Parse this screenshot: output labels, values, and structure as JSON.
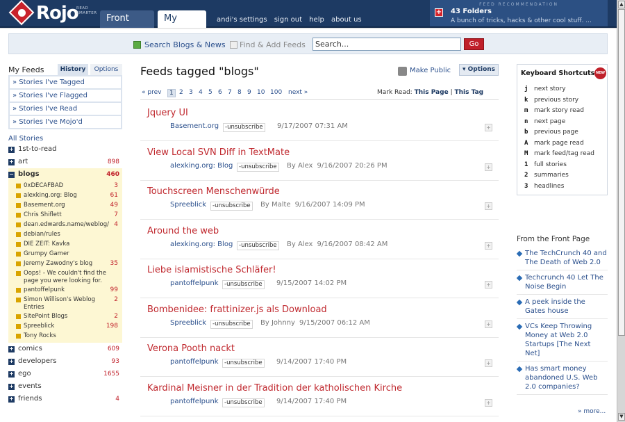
{
  "header": {
    "brand": "Rojo",
    "tagline": [
      "READ",
      "SMARTER"
    ],
    "tabs": [
      {
        "label": "Front Page"
      },
      {
        "label": "My Feeds"
      }
    ],
    "links": [
      "andi's settings",
      "sign out",
      "help",
      "about us"
    ],
    "feed_rec": {
      "label": "FEED RECOMMENDATION",
      "title": "43 Folders",
      "subtitle": "A bunch of tricks, hacks & other cool stuff. ..."
    }
  },
  "search": {
    "option1": "Search Blogs & News",
    "option2": "Find & Add Feeds",
    "value": "Search...",
    "go": "Go"
  },
  "sidebar": {
    "title": "My Feeds",
    "tabs": [
      "History",
      "Options"
    ],
    "history": [
      "» Stories I've Tagged",
      "» Stories I've Flagged",
      "» Stories I've Read",
      "» Stories I've Mojo'd"
    ],
    "all_stories": "All Stories",
    "folders_top": [
      {
        "name": "1st-to-read",
        "count": ""
      },
      {
        "name": "art",
        "count": "898"
      }
    ],
    "open_folder": {
      "name": "blogs",
      "count": "460"
    },
    "blogs": [
      {
        "name": "0xDECAFBAD",
        "count": "3"
      },
      {
        "name": "alexking.org: Blog",
        "count": "61"
      },
      {
        "name": "Basement.org",
        "count": "49"
      },
      {
        "name": "Chris Shiflett",
        "count": "7"
      },
      {
        "name": "dean.edwards.name/weblog/",
        "count": "4"
      },
      {
        "name": "debian/rules",
        "count": ""
      },
      {
        "name": "DIE ZEIT: Kavka",
        "count": ""
      },
      {
        "name": "Grumpy Gamer",
        "count": ""
      },
      {
        "name": "Jeremy Zawodny's blog",
        "count": "35"
      },
      {
        "name": "Oops! - We couldn't find the page you were looking for.",
        "count": ""
      },
      {
        "name": "pantoffelpunk",
        "count": "99"
      },
      {
        "name": "Simon Willison's Weblog Entries",
        "count": "2"
      },
      {
        "name": "SitePoint Blogs",
        "count": "2"
      },
      {
        "name": "Spreeblick",
        "count": "198"
      },
      {
        "name": "Tony Rocks",
        "count": ""
      }
    ],
    "folders_bottom": [
      {
        "name": "comics",
        "count": "609"
      },
      {
        "name": "developers",
        "count": "93"
      },
      {
        "name": "ego",
        "count": "1655"
      },
      {
        "name": "events",
        "count": ""
      },
      {
        "name": "friends",
        "count": "4"
      }
    ]
  },
  "main": {
    "title": "Feeds tagged \"blogs\"",
    "make_public": "Make Public",
    "options": "Options",
    "pager": {
      "prev": "« prev",
      "pages": [
        "1",
        "2",
        "3",
        "4",
        "5",
        "6",
        "7",
        "8",
        "9",
        "10",
        "100"
      ],
      "next": "next »"
    },
    "mark_read": {
      "label": "Mark Read:",
      "this_page": "This Page",
      "sep": "|",
      "this_tag": "This Tag"
    },
    "unsubscribe": "-unsubscribe",
    "stories": [
      {
        "title": "Jquery UI",
        "source": "Basement.org",
        "author": "",
        "date": "9/17/2007 07:31 AM"
      },
      {
        "title": "View Local SVN Diff in TextMate",
        "source": "alexking.org: Blog",
        "author": "By Alex",
        "date": "9/16/2007 20:26 PM"
      },
      {
        "title": "Touchscreen Menschenwürde",
        "source": "Spreeblick",
        "author": "By Malte",
        "date": "9/16/2007 14:09 PM"
      },
      {
        "title": "Around the web",
        "source": "alexking.org: Blog",
        "author": "By Alex",
        "date": "9/16/2007 08:42 AM"
      },
      {
        "title": "Liebe islamistische Schläfer!",
        "source": "pantoffelpunk",
        "author": "",
        "date": "9/15/2007 14:02 PM"
      },
      {
        "title": "Bombenidee: frattinizer.js als Download",
        "source": "Spreeblick",
        "author": "By Johnny",
        "date": "9/15/2007 06:12 AM"
      },
      {
        "title": "Verona Pooth nackt",
        "source": "pantoffelpunk",
        "author": "",
        "date": "9/14/2007 17:40 PM"
      },
      {
        "title": "Kardinal Meisner in der Tradition der katholischen Kirche",
        "source": "pantoffelpunk",
        "author": "",
        "date": "9/14/2007 17:40 PM"
      }
    ]
  },
  "right": {
    "shortcuts_title": "Keyboard Shortcuts",
    "new_badge": "NEW",
    "shortcuts": [
      {
        "key": "j",
        "desc": "next story"
      },
      {
        "key": "k",
        "desc": "previous story"
      },
      {
        "key": "m",
        "desc": "mark story read"
      },
      {
        "key": "n",
        "desc": "next page"
      },
      {
        "key": "b",
        "desc": "previous page"
      },
      {
        "key": "A",
        "desc": "mark page read"
      },
      {
        "key": "M",
        "desc": "mark feed/tag read"
      },
      {
        "key": "1",
        "desc": "full stories"
      },
      {
        "key": "2",
        "desc": "summaries"
      },
      {
        "key": "3",
        "desc": "headlines"
      }
    ],
    "front_page_title": "From the Front Page",
    "front_page": [
      "The TechCrunch 40 and The Death of Web 2.0",
      "Techcrunch 40 Let The Noise Begin",
      "A peek inside the Gates house",
      "VCs Keep Throwing Money at Web 2.0 Startups [The Next Net]",
      "Has smart money abandoned U.S. Web 2.0 companies?"
    ],
    "more": "» more..."
  },
  "colors": {
    "header": "#1d3a63",
    "accent": "#c0202a",
    "link": "#2a4f8c",
    "blogs_bg": "#fdf7d3"
  }
}
